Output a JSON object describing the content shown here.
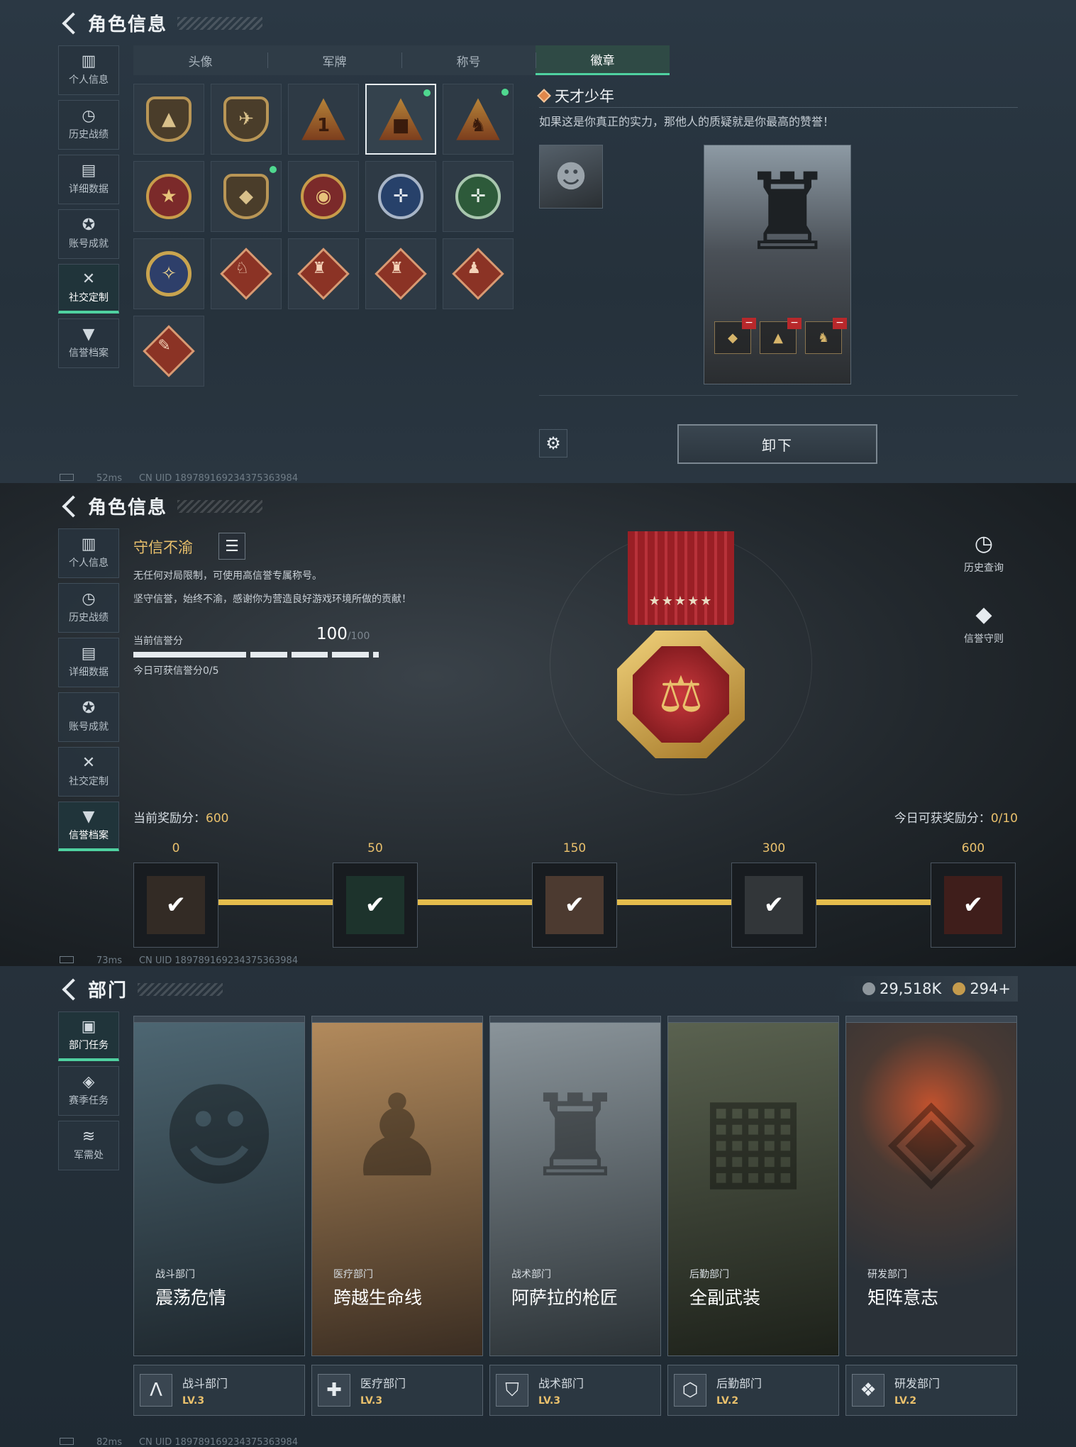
{
  "p1": {
    "title": "角色信息",
    "sidebar": [
      {
        "label": "个人信息",
        "icon": "bar-chart-icon"
      },
      {
        "label": "历史战绩",
        "icon": "clock-icon"
      },
      {
        "label": "详细数据",
        "icon": "folder-icon"
      },
      {
        "label": "账号成就",
        "icon": "medal-icon"
      },
      {
        "label": "社交定制",
        "icon": "tools-icon",
        "active": true
      },
      {
        "label": "信誉档案",
        "icon": "shield-icon"
      }
    ],
    "tabs": [
      "头像",
      "军牌",
      "称号",
      "徽章"
    ],
    "active_tab": "徽章",
    "badge_icons": [
      "triangle-emblem-icon",
      "helicopter-emblem-icon",
      "number-one-emblem-icon",
      "tower-emblem-icon",
      "soldier-emblem-icon",
      "star-crest-icon",
      "shield-crest-icon",
      "winged-crest-icon",
      "blue-rifle-crest-icon",
      "green-rifle-crest-icon",
      "gold-crest-icon",
      "wolf-diamond-icon",
      "dragon-diamond-icon",
      "dragon2-diamond-icon",
      "runner-diamond-icon",
      "wrench-diamond-icon"
    ],
    "badge_name": "天才少年",
    "badge_desc": "如果这是你真正的实力，那他人的质疑就是你最高的赞誉！",
    "unequip": "卸下",
    "status": {
      "ping": "52ms",
      "uid": "CN UID 1897891692343753639​84"
    }
  },
  "p2": {
    "title": "角色信息",
    "sidebar": [
      {
        "label": "个人信息",
        "icon": "bar-chart-icon"
      },
      {
        "label": "历史战绩",
        "icon": "clock-icon"
      },
      {
        "label": "详细数据",
        "icon": "folder-icon"
      },
      {
        "label": "账号成就",
        "icon": "medal-icon"
      },
      {
        "label": "社交定制",
        "icon": "tools-icon"
      },
      {
        "label": "信誉档案",
        "icon": "shield-icon",
        "active": true
      }
    ],
    "rep_title": "守信不渝",
    "line1": "无任何对局限制，可使用高信誉专属称号。",
    "line2": "坚守信誉，始终不渝，感谢你为营造良好游戏环境所做的贡献！",
    "score_label": "当前信誉分",
    "score": "100",
    "score_max": "/100",
    "today_score": "今日可获信誉分0/5",
    "history": "历史查询",
    "rules": "信誉守则",
    "reward_label": "当前奖励分：",
    "reward_value": "600",
    "today_reward_label": "今日可获奖励分：",
    "today_reward_value": "0/10",
    "milestones": [
      "0",
      "50",
      "150",
      "300",
      "600"
    ],
    "status": {
      "ping": "73ms",
      "uid": "CN UID 1897891692343753639​84"
    }
  },
  "p3": {
    "title": "部门",
    "sidebar": [
      {
        "label": "部门任务",
        "icon": "task-icon",
        "active": true
      },
      {
        "label": "赛季任务",
        "icon": "season-icon"
      },
      {
        "label": "军需处",
        "icon": "supply-icon"
      }
    ],
    "currency1": "29,518K",
    "currency2": "294+",
    "cards": [
      {
        "sub": "战斗部门",
        "title": "震荡危情",
        "dept": "战斗部门",
        "lv": "LV.3",
        "color": "#3f5560",
        "icon": "combat-icon"
      },
      {
        "sub": "医疗部门",
        "title": "跨越生命线",
        "dept": "医疗部门",
        "lv": "LV.3",
        "color": "#6a5438",
        "icon": "medical-icon"
      },
      {
        "sub": "战术部门",
        "title": "阿萨拉的枪匠",
        "dept": "战术部门",
        "lv": "LV.3",
        "color": "#4b5a63",
        "icon": "tactical-icon"
      },
      {
        "sub": "后勤部门",
        "title": "全副武装",
        "dept": "后勤部门",
        "lv": "LV.2",
        "color": "#39402f",
        "icon": "logistics-icon"
      },
      {
        "sub": "研发部门",
        "title": "矩阵意志",
        "dept": "研发部门",
        "lv": "LV.2",
        "color": "#3e4a55",
        "icon": "research-icon"
      }
    ],
    "status": {
      "ping": "82ms",
      "uid": "CN UID 1897891692343753639​84"
    }
  }
}
